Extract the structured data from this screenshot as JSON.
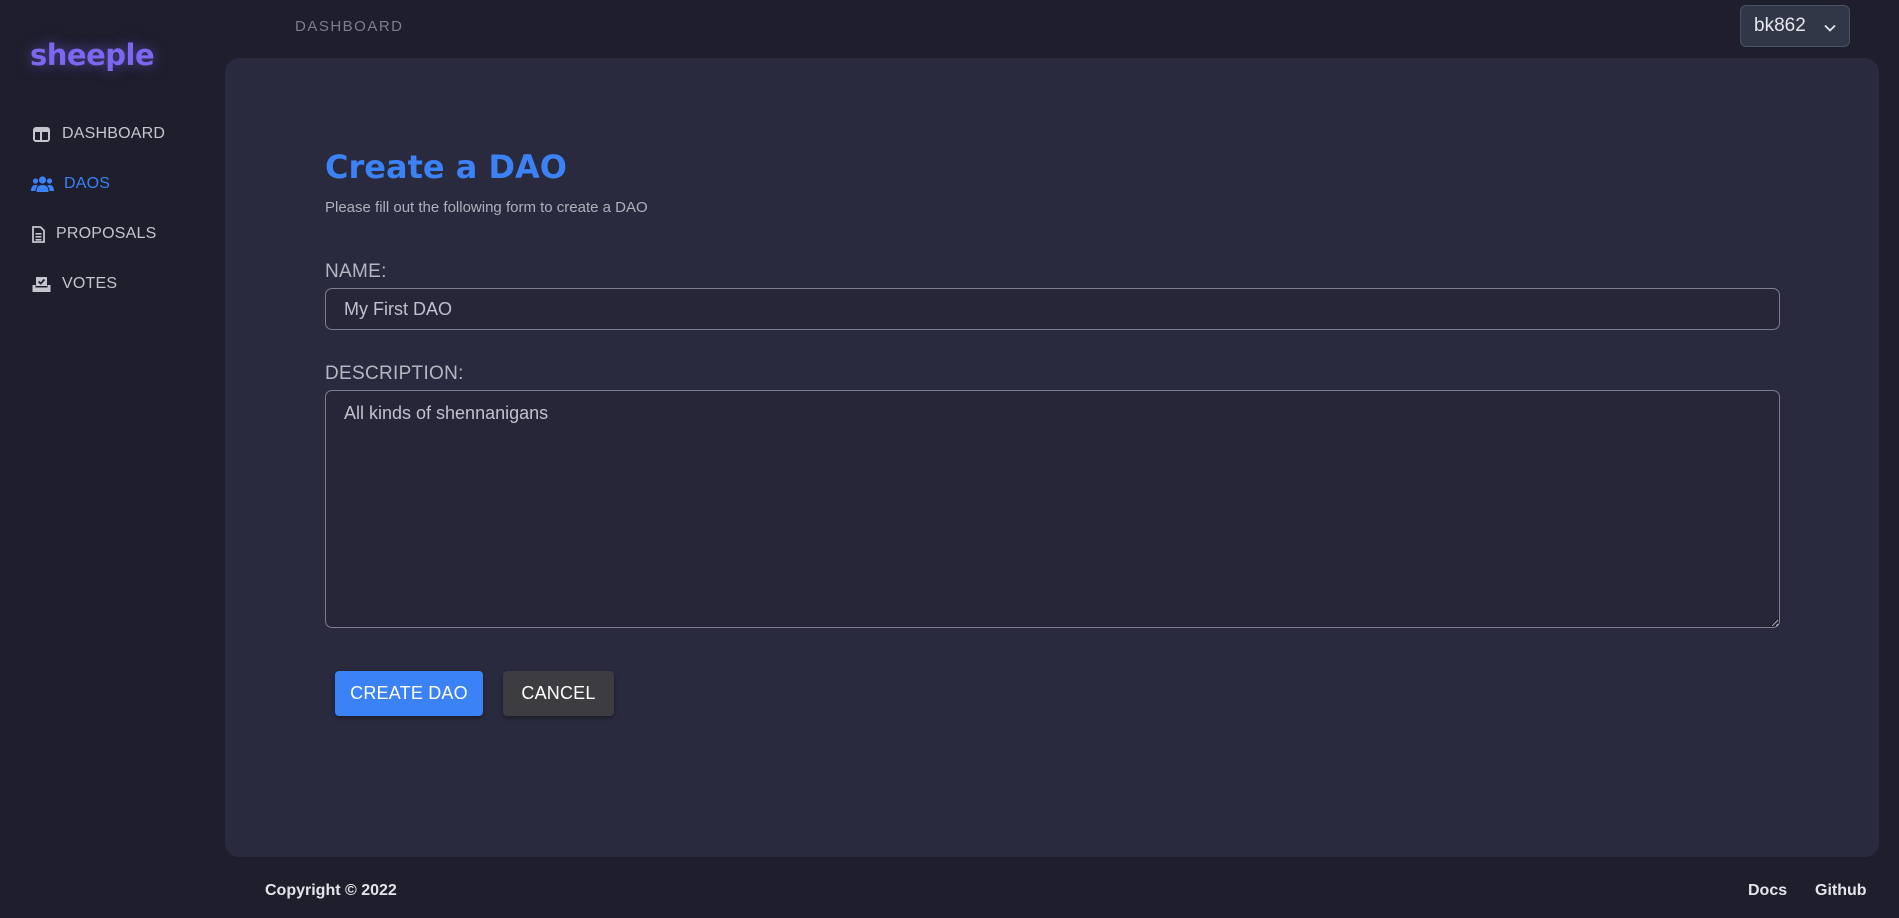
{
  "app": {
    "logo": "sheeple"
  },
  "breadcrumb": "DASHBOARD",
  "user": {
    "account": "bk862"
  },
  "sidebar": {
    "items": [
      {
        "label": "DASHBOARD",
        "icon": "layout-icon",
        "active": false
      },
      {
        "label": "DAOS",
        "icon": "users-icon",
        "active": true
      },
      {
        "label": "PROPOSALS",
        "icon": "document-icon",
        "active": false
      },
      {
        "label": "VOTES",
        "icon": "vote-box-icon",
        "active": false
      }
    ]
  },
  "form": {
    "title": "Create a DAO",
    "subtitle": "Please fill out the following form to create a DAO",
    "name_label": "NAME:",
    "name_value": "My First DAO",
    "description_label": "DESCRIPTION:",
    "description_value": "All kinds of shennanigans",
    "submit_label": "CREATE DAO",
    "cancel_label": "CANCEL"
  },
  "footer": {
    "copyright": "Copyright © 2022",
    "links": [
      "Docs",
      "Github"
    ]
  },
  "colors": {
    "accent": "#3b82f6",
    "logo": "#7b68f0",
    "background": "#1e1e2c",
    "card": "#292a3e"
  }
}
